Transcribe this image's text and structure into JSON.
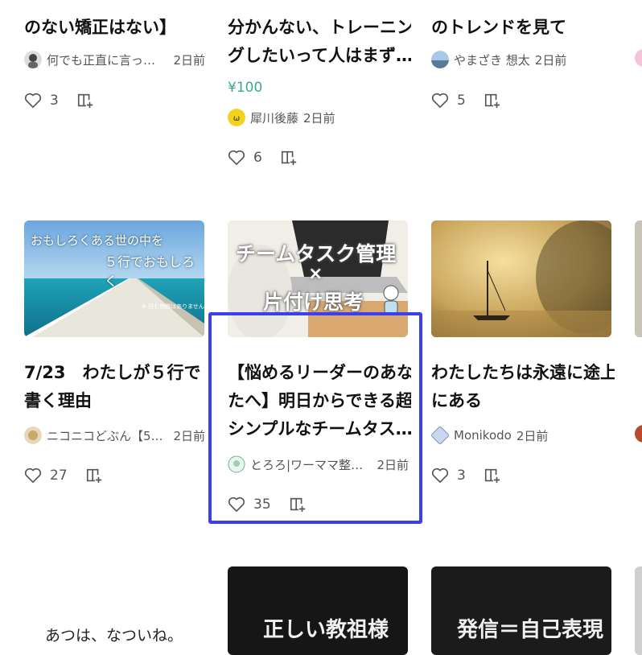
{
  "row1": {
    "col1": {
      "title_line2": "のない矯正はない】",
      "author": "何でも正直に言っち…",
      "time": "2日前",
      "likes": "3"
    },
    "col2": {
      "title_line1": "分かんない、トレーニン",
      "title_line2": "グしたいって人はまず…",
      "price": "¥100",
      "author": "犀川後藤",
      "time": "2日前",
      "likes": "6"
    },
    "col3": {
      "title_line2": "のトレンドを見て",
      "author": "やまざき 想太",
      "time": "2日前",
      "likes": "5"
    }
  },
  "row2": {
    "col1": {
      "thumb_text1": "おもしろくある世の中を",
      "thumb_text2": "５行でおもしろく",
      "thumb_note": "※ 読む価値はありません",
      "title_line1": "7/23　わたしが５行で",
      "title_line2": "書く理由",
      "author": "ニコニコどぶん【5行…",
      "time": "2日前",
      "likes": "27"
    },
    "col2": {
      "thumb_text1": "チームタスク管理",
      "thumb_text2": "×",
      "thumb_text3": "片付け思考",
      "title_line1": "【悩めるリーダーのあな",
      "title_line2": "たへ】明日からできる超",
      "title_line3": "シンプルなチームタス…",
      "author": "とろろ|ワーママ整理…",
      "time": "2日前",
      "likes": "35"
    },
    "col3": {
      "title_line1": "わたしたちは永遠に途上",
      "title_line2": "にある",
      "author": "Monikodo",
      "time": "2日前",
      "likes": "3"
    }
  },
  "row3": {
    "col1": {
      "text": "あつは、なついね。"
    },
    "col2": {
      "thumb_text": "正しい教祖様"
    },
    "col3": {
      "thumb_text": "発信＝自己表現"
    }
  },
  "colors": {
    "accent_highlight": "#3b3ff0",
    "price": "#3aa890"
  }
}
